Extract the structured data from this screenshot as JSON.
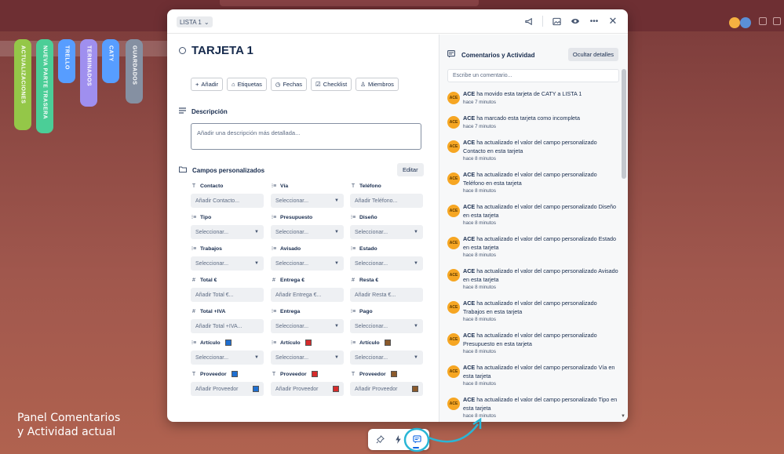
{
  "card": {
    "list_name": "LISTA 1",
    "title": "TARJETA 1",
    "actions": [
      {
        "icon": "plus-icon",
        "label": "Añadir"
      },
      {
        "icon": "tag-icon",
        "label": "Etiquetas"
      },
      {
        "icon": "clock-icon",
        "label": "Fechas"
      },
      {
        "icon": "checklist-icon",
        "label": "Checklist"
      },
      {
        "icon": "person-icon",
        "label": "Miembros"
      }
    ],
    "description": {
      "title": "Descripción",
      "placeholder": "Añadir una descripción más detallada..."
    },
    "custom_fields": {
      "title": "Campos personalizados",
      "edit_label": "Editar",
      "fields": [
        {
          "label": "Contacto",
          "type": "text",
          "value": "Añadir Contacto..."
        },
        {
          "label": "Vía",
          "type": "list",
          "value": "Seleccionar..."
        },
        {
          "label": "Teléfono",
          "type": "text",
          "value": "Añadir Teléfono..."
        },
        {
          "label": "Tipo",
          "type": "list",
          "value": "Seleccionar..."
        },
        {
          "label": "Presupuesto",
          "type": "list",
          "value": "Seleccionar..."
        },
        {
          "label": "Diseño",
          "type": "list",
          "value": "Seleccionar..."
        },
        {
          "label": "Trabajos",
          "type": "list",
          "value": "Seleccionar..."
        },
        {
          "label": "Avisado",
          "type": "list",
          "value": "Seleccionar..."
        },
        {
          "label": "Estado",
          "type": "list",
          "value": "Seleccionar..."
        },
        {
          "label": "Total €",
          "type": "number",
          "value": "Añadir Total €..."
        },
        {
          "label": "Entrega €",
          "type": "number",
          "value": "Añadir Entrega €..."
        },
        {
          "label": "Resta €",
          "type": "number",
          "value": "Añadir Resta €..."
        },
        {
          "label": "Total +IVA",
          "type": "number",
          "value": "Añadir Total +IVA..."
        },
        {
          "label": "Entrega",
          "type": "list",
          "value": "Seleccionar..."
        },
        {
          "label": "Pago",
          "type": "list",
          "value": "Seleccionar..."
        },
        {
          "label": "Artículo",
          "type": "list",
          "value": "Seleccionar...",
          "swatch": "#1f6fd1"
        },
        {
          "label": "Artículo",
          "type": "list",
          "value": "Seleccionar...",
          "swatch": "#d62b2b"
        },
        {
          "label": "Artículo",
          "type": "list",
          "value": "Seleccionar...",
          "swatch": "#8b5a2b"
        },
        {
          "label": "Proveedor",
          "type": "text",
          "value": "Añadir Proveedor",
          "swatch": "#1f6fd1"
        },
        {
          "label": "Proveedor",
          "type": "text",
          "value": "Añadir Proveedor",
          "swatch": "#d62b2b"
        },
        {
          "label": "Proveedor",
          "type": "text",
          "value": "Añadir Proveedor",
          "swatch": "#8b5a2b"
        }
      ]
    }
  },
  "activity_panel": {
    "title": "Comentarios y Actividad",
    "hide_label": "Ocultar detalles",
    "comment_placeholder": "Escribe un comentario...",
    "items": [
      {
        "user": "ACE",
        "text": "ha movido esta tarjeta de CATY a LISTA 1",
        "time": "hace 7 minutos"
      },
      {
        "user": "ACE",
        "text": "ha marcado esta tarjeta como incompleta",
        "time": "hace 7 minutos"
      },
      {
        "user": "ACE",
        "text": "ha actualizado el valor del campo personalizado Contacto en esta tarjeta",
        "time": "hace 8 minutos"
      },
      {
        "user": "ACE",
        "text": "ha actualizado el valor del campo personalizado Teléfono en esta tarjeta",
        "time": "hace 8 minutos"
      },
      {
        "user": "ACE",
        "text": "ha actualizado el valor del campo personalizado Diseño en esta tarjeta",
        "time": "hace 8 minutos"
      },
      {
        "user": "ACE",
        "text": "ha actualizado el valor del campo personalizado Estado en esta tarjeta",
        "time": "hace 8 minutos"
      },
      {
        "user": "ACE",
        "text": "ha actualizado el valor del campo personalizado Avisado en esta tarjeta",
        "time": "hace 8 minutos"
      },
      {
        "user": "ACE",
        "text": "ha actualizado el valor del campo personalizado Trabajos en esta tarjeta",
        "time": "hace 8 minutos"
      },
      {
        "user": "ACE",
        "text": "ha actualizado el valor del campo personalizado Presupuesto en esta tarjeta",
        "time": "hace 8 minutos"
      },
      {
        "user": "ACE",
        "text": "ha actualizado el valor del campo personalizado Vía en esta tarjeta",
        "time": "hace 8 minutos"
      },
      {
        "user": "ACE",
        "text": "ha actualizado el valor del campo personalizado Tipo en esta tarjeta",
        "time": "hace 8 minutos"
      }
    ]
  },
  "board_lists": [
    {
      "label": "ACTUALIZACIONES",
      "color": "#94c748"
    },
    {
      "label": "NUEVA PARTE TRASERA",
      "color": "#4bce97"
    },
    {
      "label": "TRELLO",
      "color": "#579dff"
    },
    {
      "label": "TERMINADOS",
      "color": "#9f8fef"
    },
    {
      "label": "CATY",
      "color": "#579dff"
    },
    {
      "label": "GUARDADOS",
      "color": "#8590a2"
    }
  ],
  "toolbar": {
    "items": [
      "pin-icon",
      "bolt-icon",
      "comment-icon"
    ]
  },
  "annotation": {
    "line1": "Panel Comentarios",
    "line2": "y Actividad actual",
    "color": "#29b6d6"
  }
}
